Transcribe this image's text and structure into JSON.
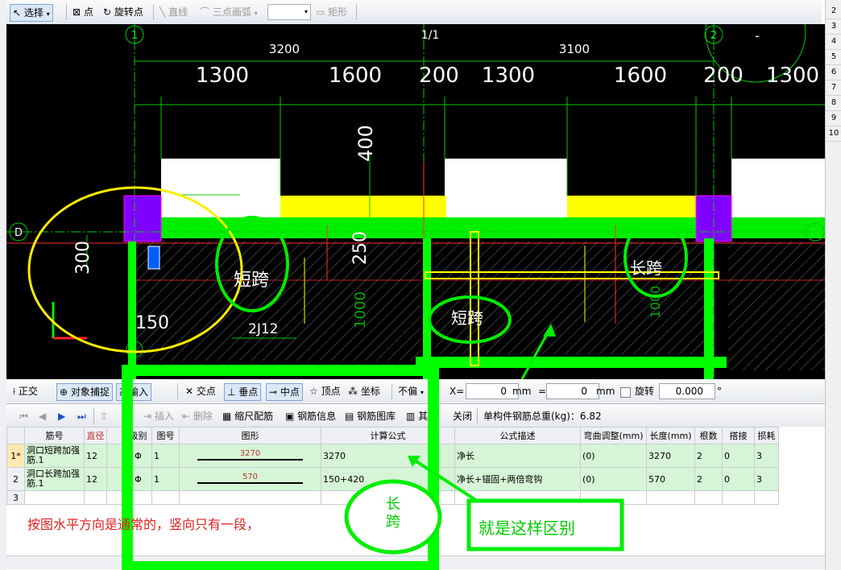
{
  "toolbar": {
    "select": "选择",
    "point": "点",
    "rotate_point": "旋转点",
    "line": "直线",
    "three_point_arc": "三点画弧",
    "rect": "矩形"
  },
  "right_panel": {
    "numbers": [
      "2",
      "3",
      "4",
      "5",
      "6",
      "7",
      "8",
      "9",
      "10"
    ]
  },
  "drawing": {
    "axis_labels": {
      "a1": "1",
      "a11": "1/1",
      "a2": "2",
      "dleft": "D",
      "dright": "D",
      "dbot": "1",
      "topright": "-"
    },
    "dims_top": {
      "d3200": "3200",
      "d3100": "3100"
    },
    "dims_main": [
      "1300",
      "1600",
      "200",
      "1300",
      "1600",
      "200",
      "1300"
    ],
    "dim400": "400",
    "dim250": "250",
    "dim300": "300",
    "dim150": "150",
    "dim1000": "1000",
    "dim1000b": "1000",
    "rebar_top": "2J12",
    "rebar_bot": "2J12",
    "note_short_span_1": "短跨",
    "note_short_span_2": "短跨",
    "note_long_span": "长跨"
  },
  "toolbar2": {
    "ortho": "正交",
    "snap": "对象捕捉",
    "dyn_input": "态输入",
    "intersection": "交点",
    "perpendicular": "垂点",
    "midpoint": "中点",
    "vertex": "顶点",
    "coord": "坐标",
    "no_offset": "不偏",
    "x_label": "X=",
    "x_value": "0",
    "unit1": "mm",
    "y_label": "=",
    "y_value": "0",
    "unit2": "mm",
    "rotate_label": "旋转",
    "rotate_value": "0.000",
    "degree": "°"
  },
  "toolbar3": {
    "insert": "插入",
    "delete": "删除",
    "scale_rebar": "缩尺配筋",
    "rebar_info": "钢筋信息",
    "rebar_lib": "钢筋图库",
    "other": "其",
    "close": "关闭",
    "weight_label": "单构件钢筋总重(kg)：6.82"
  },
  "table": {
    "headers": [
      "筋号",
      "直径",
      "",
      "级别",
      "图号",
      "图形",
      "计算公式",
      "公式描述",
      "弯曲调整(mm)",
      "长度(mm)",
      "根数",
      "搭接",
      "损耗"
    ],
    "rows": [
      {
        "no": "1*",
        "name": "洞口短跨加强筋.1",
        "dia": "12",
        "grade": "Φ",
        "fig": "1",
        "shape": "3270",
        "formula": "3270",
        "desc": "净长",
        "bend": "(0)",
        "length": "3270",
        "count": "2",
        "lap": "0",
        "loss": "3"
      },
      {
        "no": "2",
        "name": "洞口长跨加强筋.1",
        "dia": "12",
        "grade": "Φ",
        "fig": "1",
        "shape": "570",
        "formula": "150+420",
        "desc": "净长+锚固+两倍弯钩",
        "bend": "(0)",
        "length": "570",
        "count": "2",
        "lap": "0",
        "loss": "3"
      },
      {
        "no": "3",
        "name": "",
        "dia": "",
        "grade": "",
        "fig": "",
        "shape": "",
        "formula": "",
        "desc": "",
        "bend": "",
        "length": "",
        "count": "",
        "lap": "",
        "loss": ""
      }
    ]
  },
  "annotations": {
    "note": "按图水平方向是通常的，竖向只有一段，",
    "long_span": "长\n跨",
    "diff": "就是这样区别"
  },
  "colors": {
    "canvas_bg": "#000000",
    "rebar_green": "#00ff00",
    "yellow": "#ffff00",
    "purple": "#8000ff",
    "dim_white": "#ffffff",
    "table_row": "#d6f5d6"
  }
}
